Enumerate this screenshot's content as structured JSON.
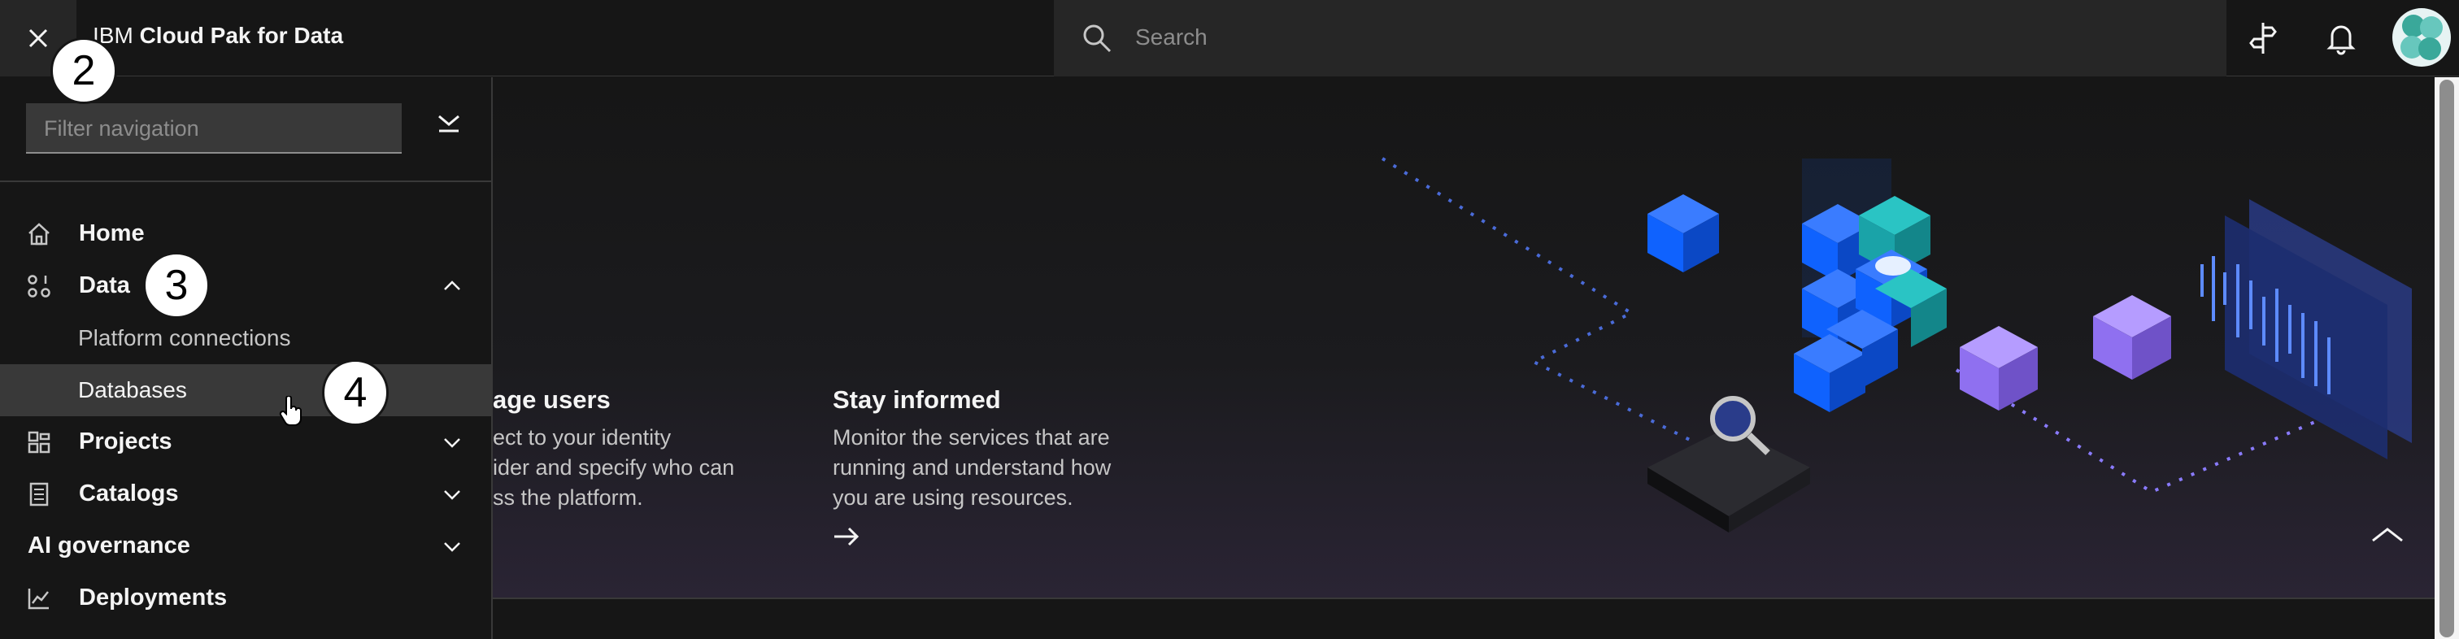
{
  "header": {
    "brand_prefix": "IBM",
    "brand_name": "Cloud Pak for Data",
    "search_placeholder": "Search"
  },
  "sidebar": {
    "filter_placeholder": "Filter navigation",
    "items": [
      {
        "label": "Home",
        "icon": "home-icon"
      },
      {
        "label": "Data",
        "icon": "data-icon",
        "expanded": true
      },
      {
        "label": "Platform connections"
      },
      {
        "label": "Databases",
        "selected": true
      },
      {
        "label": "Projects",
        "icon": "projects-icon",
        "expanded": false
      },
      {
        "label": "Catalogs",
        "icon": "catalogs-icon",
        "expanded": false
      },
      {
        "label": "AI governance",
        "expanded": false
      },
      {
        "label": "Deployments",
        "icon": "deployments-icon"
      }
    ]
  },
  "main": {
    "tiles": [
      {
        "title": "age users",
        "desc": [
          "ect to your identity",
          "ider and specify who can",
          "ss the platform."
        ]
      },
      {
        "title": "Stay informed",
        "desc": [
          "Monitor the services that are",
          "running and understand how",
          "you are using resources."
        ]
      }
    ]
  },
  "steps": [
    "2",
    "3",
    "4"
  ],
  "colors": {
    "accent": "#0f62fe",
    "background": "#161616",
    "panel": "#262626"
  }
}
